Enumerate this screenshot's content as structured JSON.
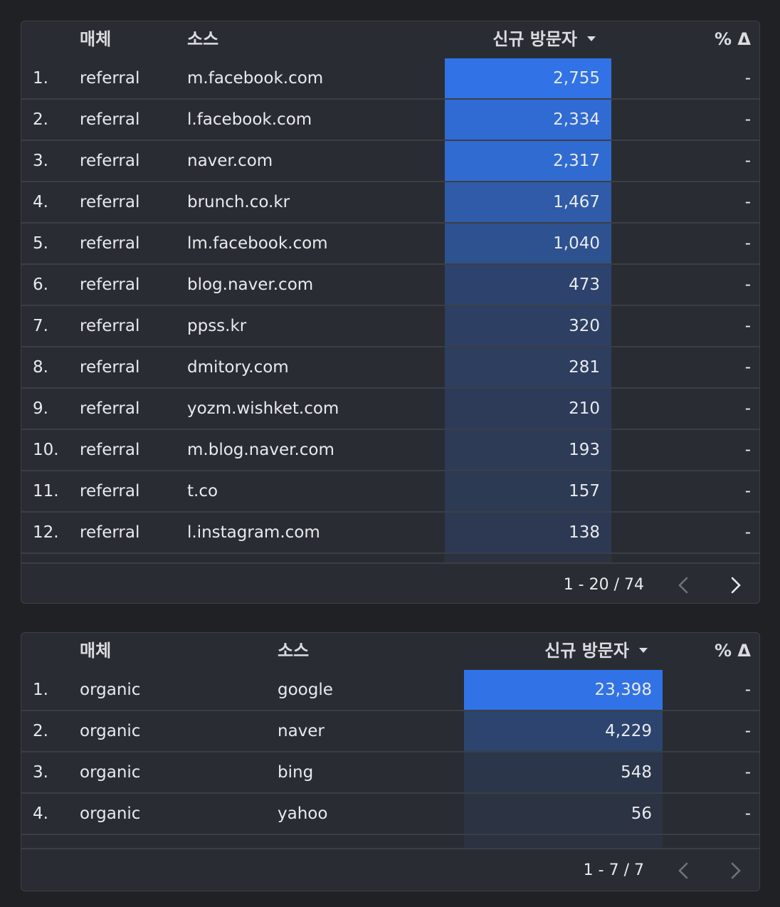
{
  "table1": {
    "headers": {
      "medium": "매체",
      "source": "소스",
      "metric": "신규 방문자",
      "delta": "% Δ"
    },
    "rows": [
      {
        "rank": "1.",
        "medium": "referral",
        "source": "m.facebook.com",
        "value": "2,755",
        "num": 2755,
        "delta": "-"
      },
      {
        "rank": "2.",
        "medium": "referral",
        "source": "l.facebook.com",
        "value": "2,334",
        "num": 2334,
        "delta": "-"
      },
      {
        "rank": "3.",
        "medium": "referral",
        "source": "naver.com",
        "value": "2,317",
        "num": 2317,
        "delta": "-"
      },
      {
        "rank": "4.",
        "medium": "referral",
        "source": "brunch.co.kr",
        "value": "1,467",
        "num": 1467,
        "delta": "-"
      },
      {
        "rank": "5.",
        "medium": "referral",
        "source": "lm.facebook.com",
        "value": "1,040",
        "num": 1040,
        "delta": "-"
      },
      {
        "rank": "6.",
        "medium": "referral",
        "source": "blog.naver.com",
        "value": "473",
        "num": 473,
        "delta": "-"
      },
      {
        "rank": "7.",
        "medium": "referral",
        "source": "ppss.kr",
        "value": "320",
        "num": 320,
        "delta": "-"
      },
      {
        "rank": "8.",
        "medium": "referral",
        "source": "dmitory.com",
        "value": "281",
        "num": 281,
        "delta": "-"
      },
      {
        "rank": "9.",
        "medium": "referral",
        "source": "yozm.wishket.com",
        "value": "210",
        "num": 210,
        "delta": "-"
      },
      {
        "rank": "10.",
        "medium": "referral",
        "source": "m.blog.naver.com",
        "value": "193",
        "num": 193,
        "delta": "-"
      },
      {
        "rank": "11.",
        "medium": "referral",
        "source": "t.co",
        "value": "157",
        "num": 157,
        "delta": "-"
      },
      {
        "rank": "12.",
        "medium": "referral",
        "source": "l.instagram.com",
        "value": "138",
        "num": 138,
        "delta": "-"
      }
    ],
    "pagination": "1 - 20 / 74",
    "icons": {
      "prev": "chevron-left-icon",
      "next": "chevron-right-icon"
    }
  },
  "table2": {
    "headers": {
      "medium": "매체",
      "source": "소스",
      "metric": "신규 방문자",
      "delta": "% Δ"
    },
    "rows": [
      {
        "rank": "1.",
        "medium": "organic",
        "source": "google",
        "value": "23,398",
        "num": 23398,
        "delta": "-"
      },
      {
        "rank": "2.",
        "medium": "organic",
        "source": "naver",
        "value": "4,229",
        "num": 4229,
        "delta": "-"
      },
      {
        "rank": "3.",
        "medium": "organic",
        "source": "bing",
        "value": "548",
        "num": 548,
        "delta": "-"
      },
      {
        "rank": "4.",
        "medium": "organic",
        "source": "yahoo",
        "value": "56",
        "num": 56,
        "delta": "-"
      }
    ],
    "pagination": "1 - 7 / 7",
    "icons": {
      "prev": "chevron-left-icon",
      "next": "chevron-right-icon"
    }
  },
  "colors": {
    "bar_strong": "#3173e6",
    "bar_faint": "#2c3241",
    "page_bg": "#202124",
    "panel_bg": "#292d33"
  }
}
